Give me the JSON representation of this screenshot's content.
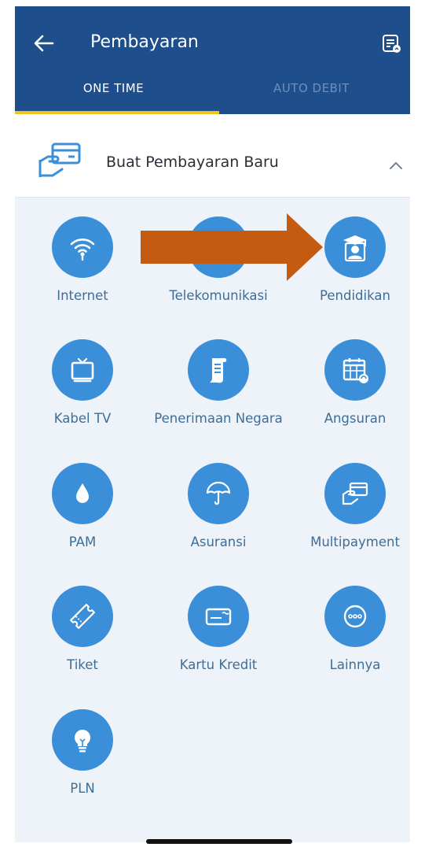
{
  "header": {
    "title": "Pembayaran",
    "back_icon": "back-arrow-icon",
    "history_icon": "payment-history-icon"
  },
  "tabs": [
    {
      "label": "ONE TIME",
      "active": true
    },
    {
      "label": "AUTO DEBIT",
      "active": false
    }
  ],
  "section": {
    "title": "Buat Pembayaran Baru",
    "icon": "card-payment-icon",
    "expanded": true
  },
  "categories": [
    {
      "label": "Internet",
      "icon": "wifi-icon"
    },
    {
      "label": "Telekomunikasi",
      "icon": "phone-icon"
    },
    {
      "label": "Pendidikan",
      "icon": "graduate-icon"
    },
    {
      "label": "Kabel TV",
      "icon": "tv-icon"
    },
    {
      "label": "Penerimaan Negara",
      "icon": "document-scroll-icon"
    },
    {
      "label": "Angsuran",
      "icon": "calendar-icon"
    },
    {
      "label": "PAM",
      "icon": "water-drop-icon"
    },
    {
      "label": "Asuransi",
      "icon": "umbrella-icon"
    },
    {
      "label": "Multipayment",
      "icon": "card-hand-icon"
    },
    {
      "label": "Tiket",
      "icon": "ticket-icon"
    },
    {
      "label": "Kartu Kredit",
      "icon": "credit-card-icon"
    },
    {
      "label": "Lainnya",
      "icon": "more-dots-icon"
    },
    {
      "label": "PLN",
      "icon": "light-bulb-icon"
    }
  ],
  "colors": {
    "header_bg": "#1e4e8c",
    "tab_indicator": "#f2c21d",
    "icon_circle": "#3b8fd9",
    "label_text": "#3e6d96",
    "annotation_arrow": "#c55a11"
  }
}
